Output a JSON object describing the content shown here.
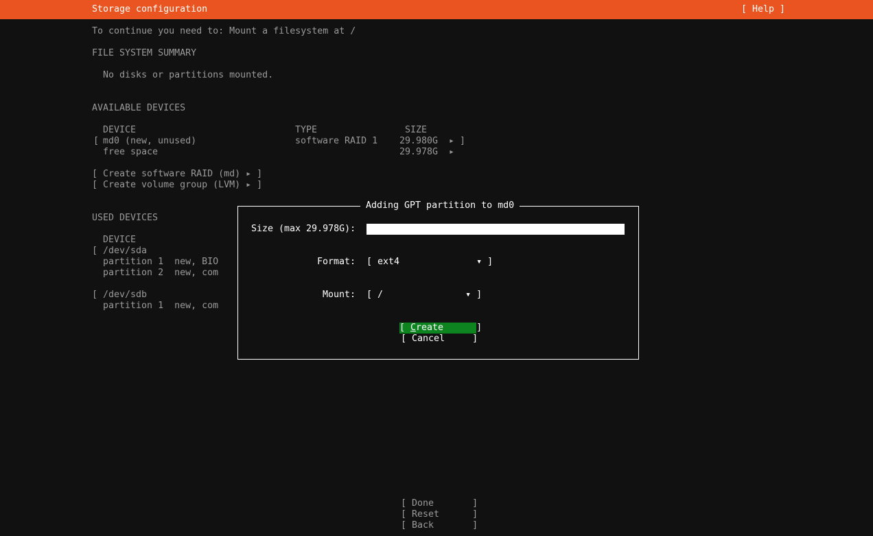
{
  "header": {
    "title": "Storage configuration",
    "help": "[ Help ]"
  },
  "instruction": "To continue you need to: Mount a filesystem at /",
  "fs_summary": {
    "heading": "FILE SYSTEM SUMMARY",
    "empty": "No disks or partitions mounted."
  },
  "available": {
    "heading": "AVAILABLE DEVICES",
    "columns": {
      "device": "DEVICE",
      "type": "TYPE",
      "size": "SIZE"
    },
    "rows": [
      {
        "open": "[",
        "device": "md0 (new, unused)",
        "type": "software RAID 1",
        "size": "29.980G",
        "arrow": "▸",
        "close": "]"
      },
      {
        "open": "",
        "device": "free space",
        "type": "",
        "size": "29.978G",
        "arrow": "▸",
        "close": ""
      }
    ],
    "actions": [
      "[ Create software RAID (md) ▸ ]",
      "[ Create volume group (LVM) ▸ ]"
    ]
  },
  "used": {
    "heading": "USED DEVICES",
    "column_device": "DEVICE",
    "lines": [
      "[ /dev/sda",
      "  partition 1  new, BIO",
      "  partition 2  new, com",
      "",
      "[ /dev/sdb",
      "  partition 1  new, com"
    ]
  },
  "dialog": {
    "title": "Adding GPT partition to md0",
    "size_label": "Size (max 29.978G):",
    "size_value": "",
    "format_label": "Format:",
    "format_value": "[ ext4              ▾ ]",
    "mount_label": "Mount:",
    "mount_value": "[ /               ▾ ]",
    "create_open": "[ ",
    "create_hotkey": "C",
    "create_rest": "reate      ]",
    "cancel": "[ Cancel     ]"
  },
  "footer": {
    "done": "[ Done       ]",
    "reset": "[ Reset      ]",
    "back": "[ Back       ]"
  },
  "colors": {
    "accent": "#e95420",
    "button_focus": "#0e8420"
  }
}
